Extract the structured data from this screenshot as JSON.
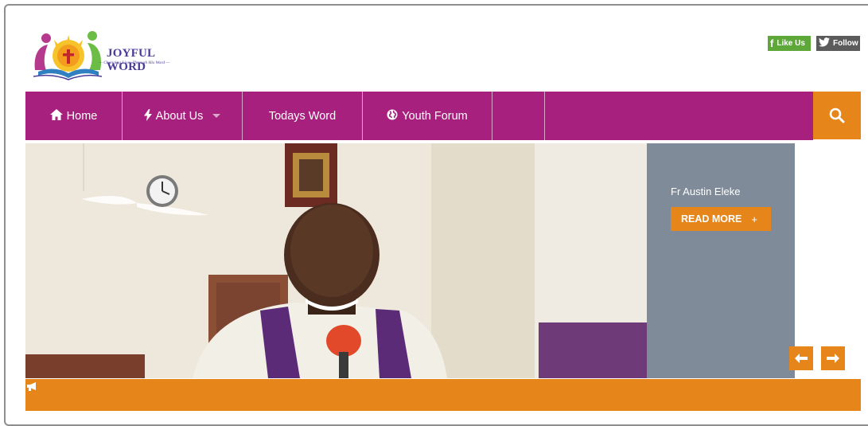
{
  "brand": {
    "title": "JOYFUL WORD",
    "tagline": "— Changing Lives Through His Word —",
    "logo_icon": "joyful-word-logo"
  },
  "social": {
    "facebook_label": "Like Us",
    "twitter_label": "Follow"
  },
  "nav": {
    "items": [
      {
        "label": "Home",
        "icon": "home-icon"
      },
      {
        "label": "About Us",
        "icon": "bolt-icon",
        "has_dropdown": true
      },
      {
        "label": "Todays Word"
      },
      {
        "label": "Youth Forum",
        "icon": "globe-icon"
      }
    ],
    "search_icon": "search-icon"
  },
  "slider": {
    "caption_title": "Fr Austin Eleke",
    "read_more_label": "READ MORE",
    "read_more_symbol": "+"
  },
  "colors": {
    "nav_bg": "#a8207e",
    "accent": "#e5851a",
    "caption_bg": "#7f8b98"
  }
}
